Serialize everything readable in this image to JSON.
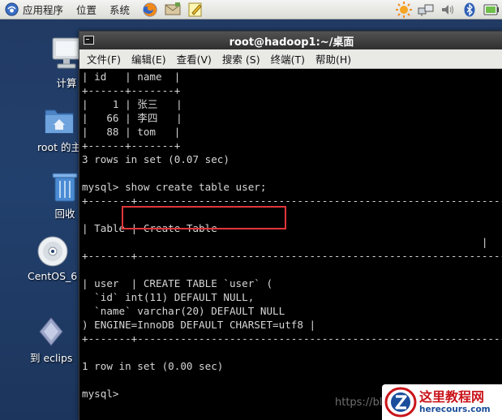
{
  "top_panel": {
    "menus": [
      "应用程序",
      "位置",
      "系统"
    ],
    "launchers": [
      "firefox-icon",
      "mail-client-icon",
      "text-editor-icon"
    ],
    "tray": [
      "weather-sun-icon",
      "network-icon",
      "volume-icon",
      "bluetooth-icon",
      "battery-icon"
    ]
  },
  "desktop": {
    "icons": [
      {
        "label": "计算",
        "icon": "computer-icon"
      },
      {
        "label": "root 的主",
        "icon": "home-folder-icon"
      },
      {
        "label": "回收",
        "icon": "trash-icon"
      },
      {
        "label": "CentOS_6",
        "icon": "disc-icon"
      },
      {
        "label": "到 eclips",
        "icon": "eclipse-link-icon"
      }
    ]
  },
  "terminal": {
    "title": "root@hadoop1:~/桌面",
    "menu": [
      "文件(F)",
      "编辑(E)",
      "查看(V)",
      "搜索 (S)",
      "终端(T)",
      "帮助(H)"
    ],
    "lines": [
      "| id   | name  |",
      "+------+-------+",
      "|    1 | 张三   |",
      "|   66 | 李四   |",
      "|   88 | tom   |",
      "+------+-------+",
      "3 rows in set (0.07 sec)",
      "",
      "mysql> show create table user;",
      "+-------+-------------------------------------------------------------+",
      "",
      "| Table | Create Table",
      "                                                                 |",
      "+-------+-------------------------------------------------------------+",
      "",
      "| user  | CREATE TABLE `user` (",
      "  `id` int(11) DEFAULT NULL,",
      "  `name` varchar(20) DEFAULT NULL",
      ") ENGINE=InnoDB DEFAULT CHARSET=utf8 |",
      "+-------+-------------------------------------------------------------+",
      "",
      "1 row in set (0.00 sec)",
      "",
      "mysql> "
    ],
    "highlight_color": "#e0353a"
  },
  "watermark": {
    "url": "https://bl",
    "site_name": "这里教程网",
    "site_domain": "herecours.com"
  }
}
